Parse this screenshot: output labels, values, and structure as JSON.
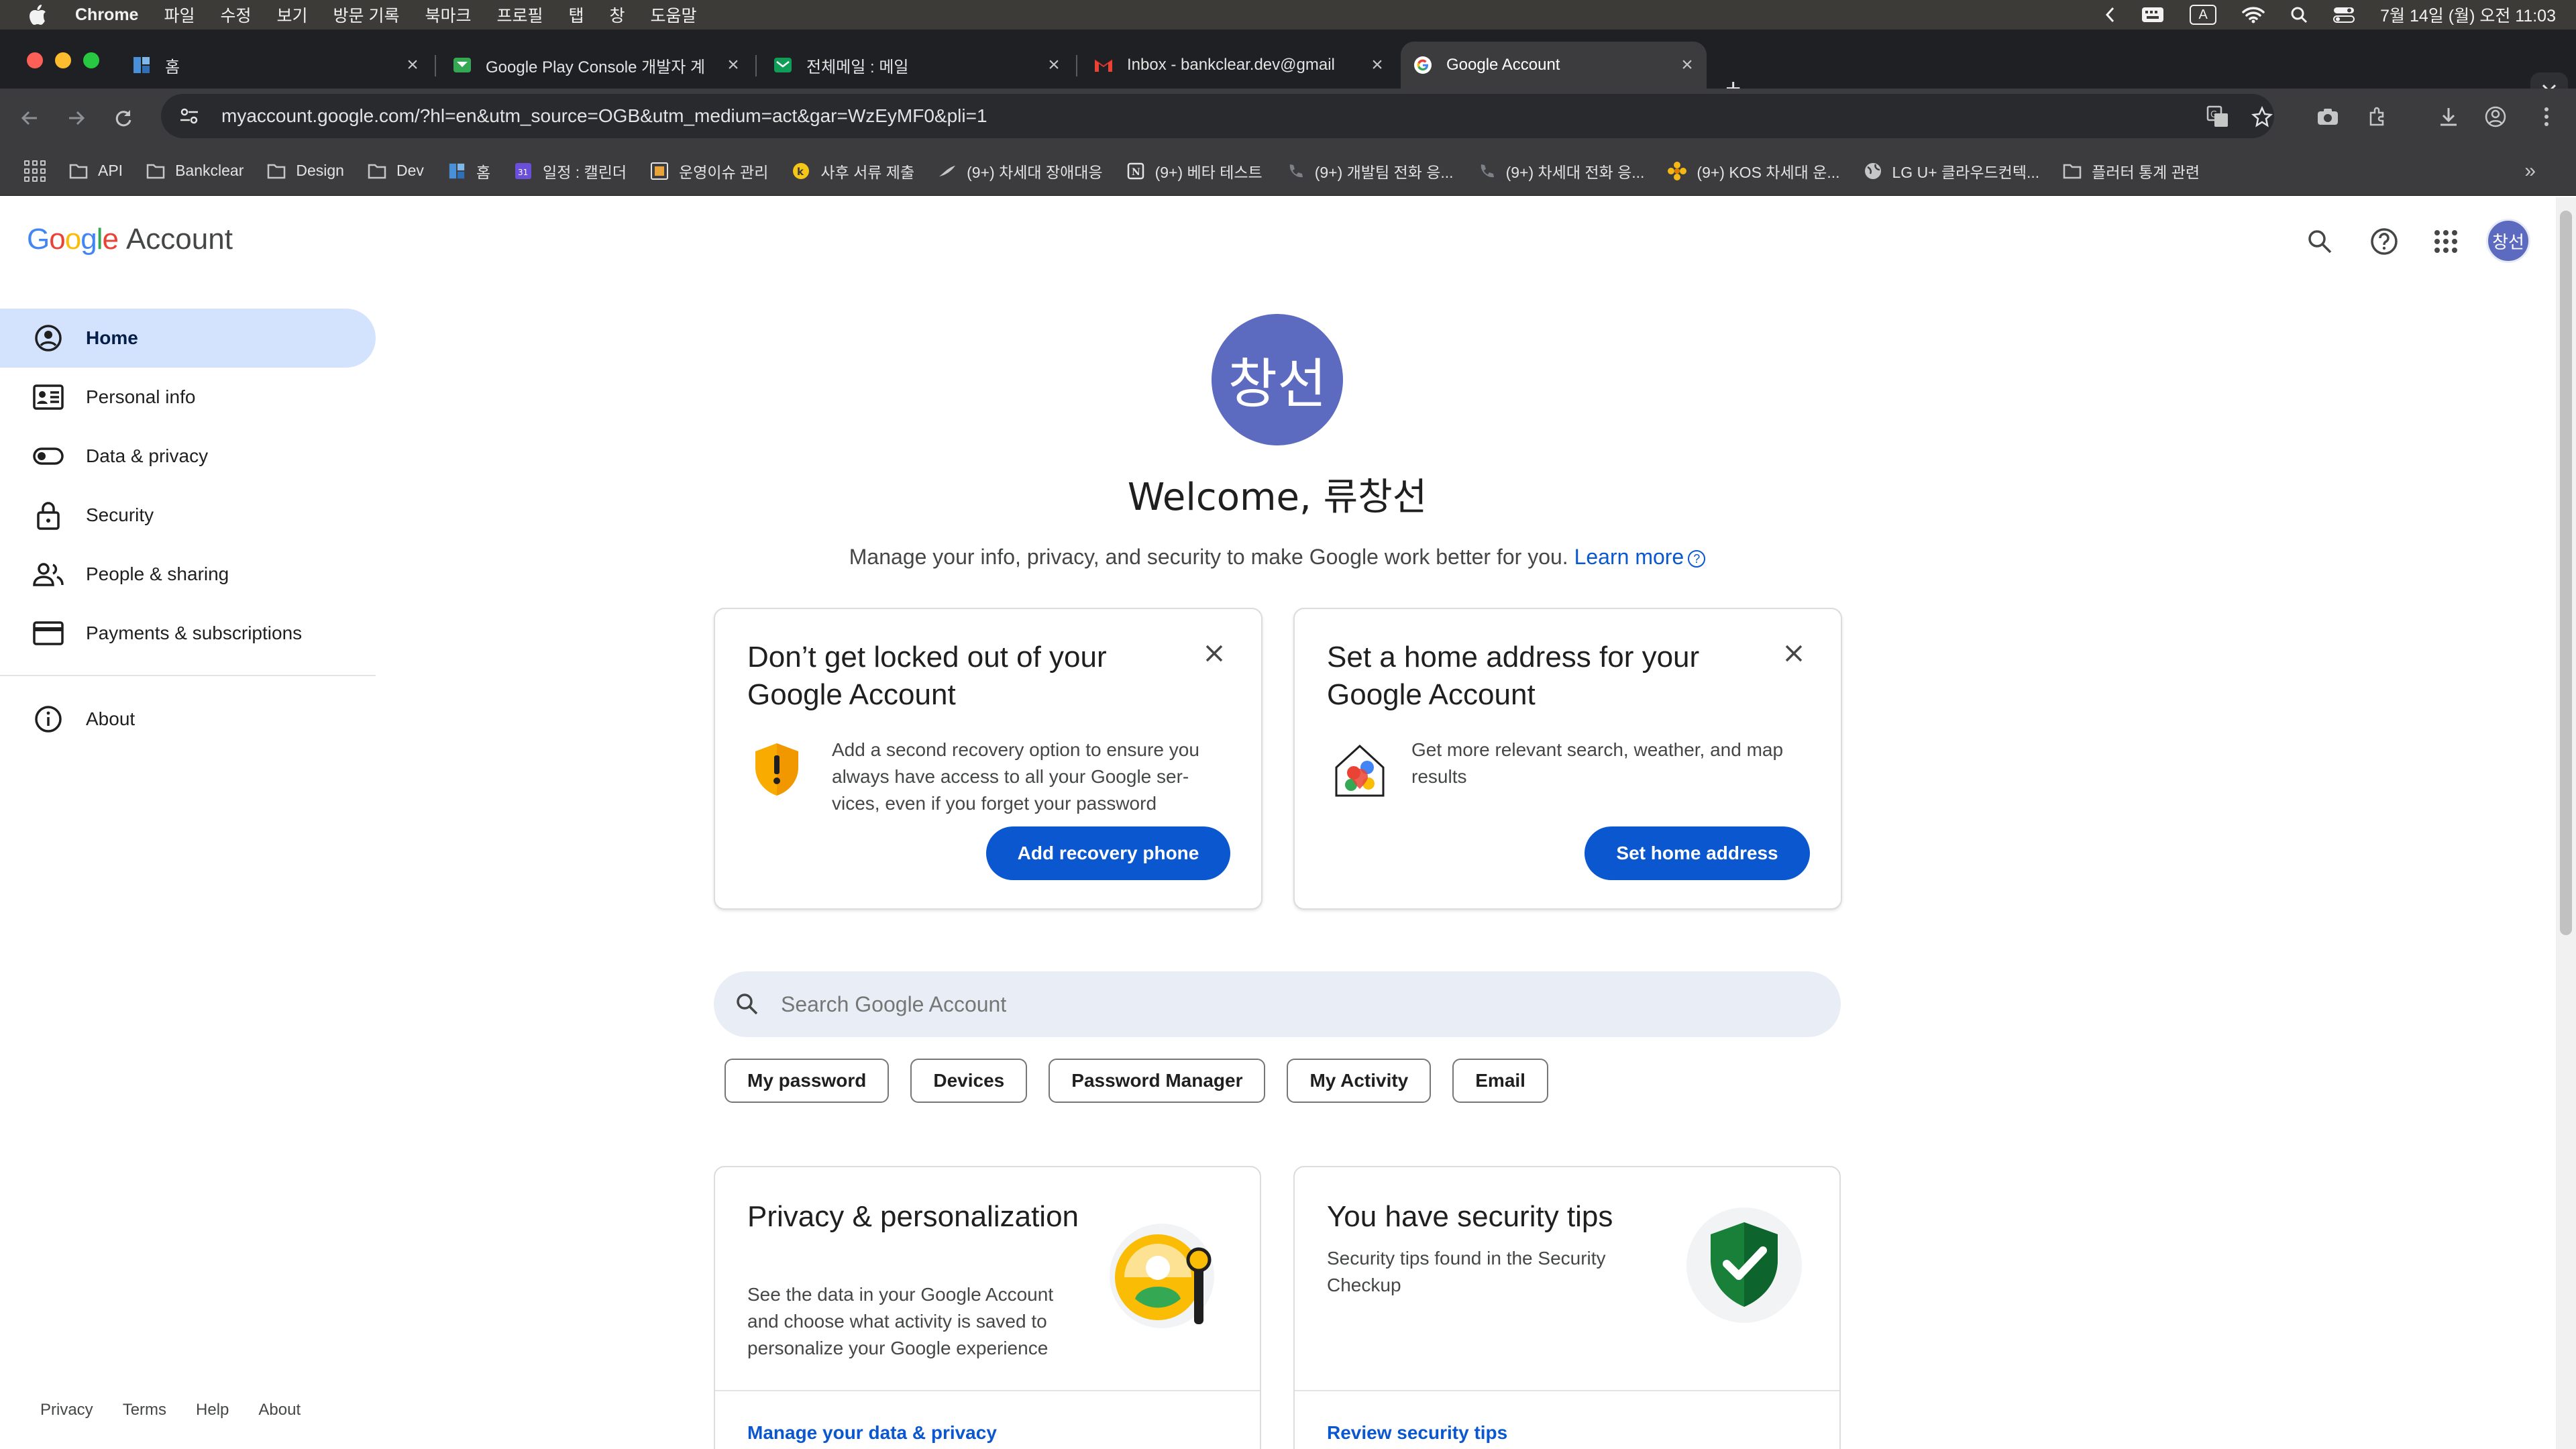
{
  "menubar": {
    "app": "Chrome",
    "items": [
      "파일",
      "수정",
      "보기",
      "방문 기록",
      "북마크",
      "프로필",
      "탭",
      "창",
      "도움말"
    ],
    "clock": "7월 14일 (월) 오전 11:03",
    "input_badge": "A"
  },
  "tabs": [
    {
      "title": "홈",
      "favicon": "grid-icon"
    },
    {
      "title": "Google Play Console 개발자 계",
      "favicon": "play-console-icon"
    },
    {
      "title": "전체메일 : 메일",
      "favicon": "mail-icon"
    },
    {
      "title": "Inbox - bankclear.dev@gmail",
      "favicon": "gmail-icon"
    },
    {
      "title": "Google Account",
      "favicon": "google-icon",
      "active": true
    }
  ],
  "toolbar": {
    "url": "myaccount.google.com/?hl=en&utm_source=OGB&utm_medium=act&gar=WzEyMF0&pli=1"
  },
  "bookmarks": [
    {
      "label": "API",
      "icon": "folder-icon"
    },
    {
      "label": "Bankclear",
      "icon": "folder-icon"
    },
    {
      "label": "Design",
      "icon": "folder-icon"
    },
    {
      "label": "Dev",
      "icon": "folder-icon"
    },
    {
      "label": "홈",
      "icon": "grid-icon"
    },
    {
      "label": "일정 : 캘린더",
      "icon": "calendar-icon"
    },
    {
      "label": "운영이슈 관리",
      "icon": "sheet-icon"
    },
    {
      "label": "사후 서류 제출",
      "icon": "k-icon"
    },
    {
      "label": "(9+) 차세대 장애대응",
      "icon": "feather-icon"
    },
    {
      "label": "(9+) 베타 테스트",
      "icon": "notion-icon"
    },
    {
      "label": "(9+) 개발팀 전화 응...",
      "icon": "phone-icon"
    },
    {
      "label": "(9+) 차세대 전화 응...",
      "icon": "phone-icon"
    },
    {
      "label": "(9+) KOS 차세대 운...",
      "icon": "flower-icon"
    },
    {
      "label": "LG U+ 클라우드컨텍...",
      "icon": "globe-icon"
    },
    {
      "label": "플러터 통계 관련",
      "icon": "folder-icon"
    }
  ],
  "header": {
    "logo_google": "Google",
    "logo_account": "Account",
    "avatar_initials": "창선"
  },
  "sidenav": {
    "items": [
      {
        "label": "Home",
        "icon": "account-circle-icon",
        "active": true
      },
      {
        "label": "Personal info",
        "icon": "id-card-icon"
      },
      {
        "label": "Data & privacy",
        "icon": "toggle-icon"
      },
      {
        "label": "Security",
        "icon": "lock-icon"
      },
      {
        "label": "People & sharing",
        "icon": "people-icon"
      },
      {
        "label": "Payments & subscriptions",
        "icon": "credit-card-icon"
      }
    ],
    "about": "About"
  },
  "footer": [
    "Privacy",
    "Terms",
    "Help",
    "About"
  ],
  "welcome": {
    "avatar_initials": "창선",
    "title": "Welcome, 류창선",
    "subtitle": "Manage your info, privacy, and security to make Google work better for you.",
    "learn_more": "Learn more"
  },
  "cards": {
    "recovery": {
      "title": "Don’t get locked out of your Google Account",
      "text": "Add a second recovery option to ensure you always have access to all your Google ser- vices, even if you forget your password",
      "button": "Add recovery phone"
    },
    "address": {
      "title": "Set a home address for your Google Account",
      "text": "Get more relevant search, weather, and map results",
      "button": "Set home address"
    }
  },
  "search": {
    "placeholder": "Search Google Account"
  },
  "chips": [
    "My password",
    "Devices",
    "Password Manager",
    "My Activity",
    "Email"
  ],
  "bottom_cards": {
    "privacy": {
      "title": "Privacy & personalization",
      "text": "See the data in your Google Account and choose what activity is saved to personalize your Google experience",
      "link": "Manage your data & privacy"
    },
    "security": {
      "title": "You have security tips",
      "text": "Security tips found in the Security Checkup",
      "link": "Review security tips"
    }
  },
  "colors": {
    "accent": "#0b57d0",
    "nav_active": "#d3e3fd",
    "avatar": "#5c6bc0"
  }
}
